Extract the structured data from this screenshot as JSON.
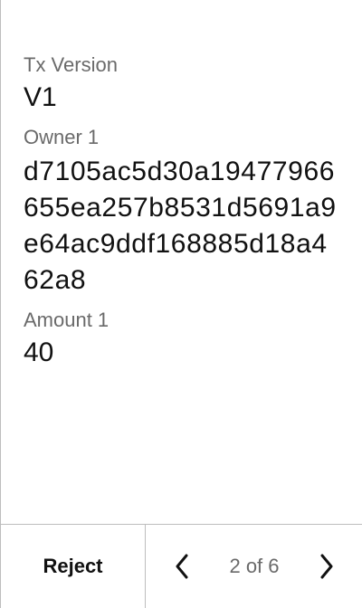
{
  "fields": [
    {
      "label": "Tx Version",
      "value": "V1"
    },
    {
      "label": "Owner 1",
      "value": "d7105ac5d30a19477966655ea257b8531d5691a9e64ac9ddf168885d18a462a8"
    },
    {
      "label": "Amount 1",
      "value": "40"
    }
  ],
  "footer": {
    "reject_label": "Reject",
    "page_current": "2",
    "page_separator": "of",
    "page_total": "6"
  },
  "icons": {
    "prev": "chevron-left-icon",
    "next": "chevron-right-icon"
  },
  "colors": {
    "text_primary": "#111111",
    "text_secondary": "#6a6a6a",
    "divider": "#bdbdbd",
    "background": "#ffffff"
  }
}
